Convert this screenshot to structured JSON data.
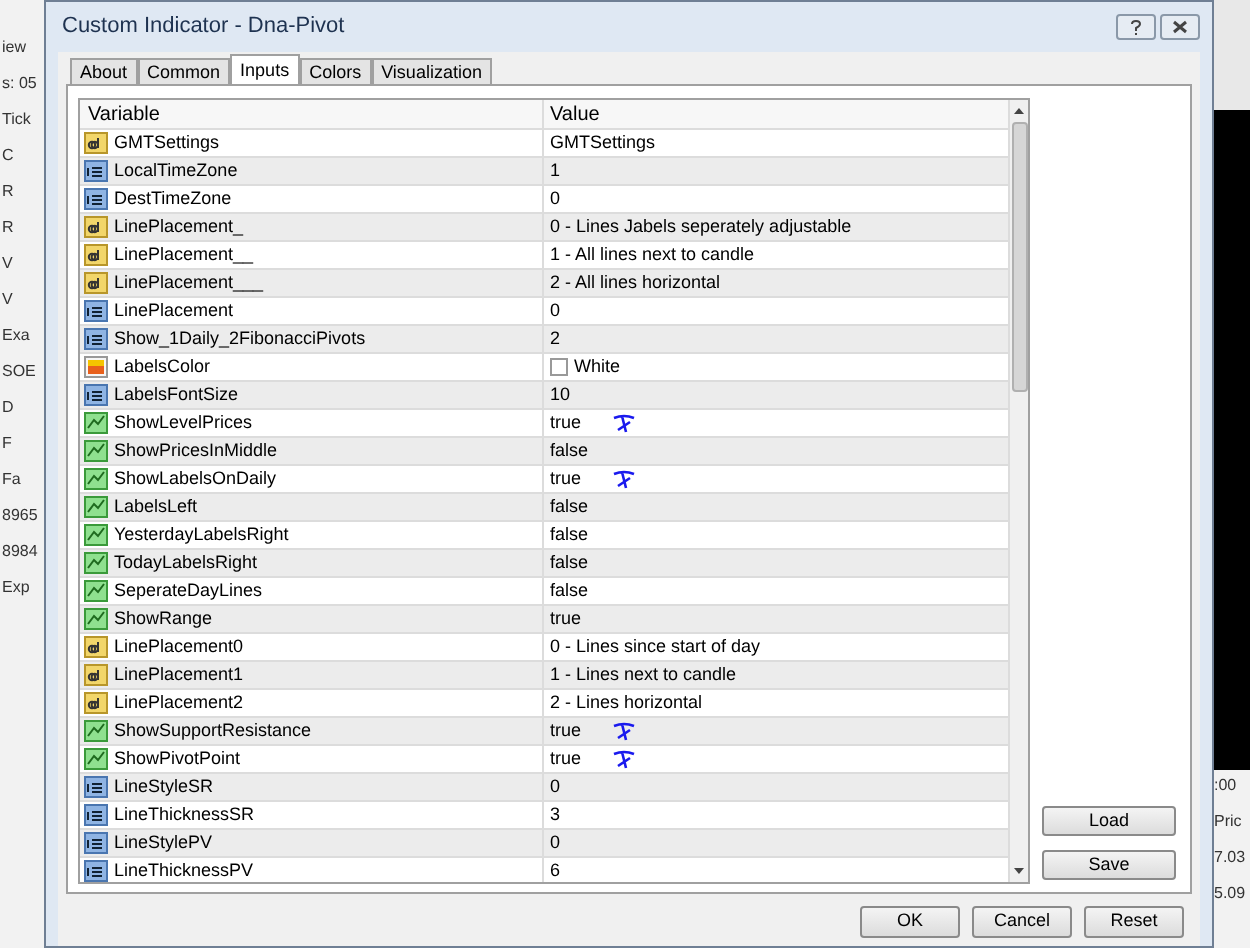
{
  "background_left": {
    "items": [
      "iew",
      "s: 05",
      "Tick",
      "C",
      "R",
      "R",
      "V",
      "V",
      "Exa",
      "SOE",
      "D",
      "F",
      "Fa",
      "8965",
      "8984",
      "Exp"
    ]
  },
  "background_right": {
    "items": [
      ":00",
      "Pric",
      "7.03",
      "5.09"
    ]
  },
  "window": {
    "title": "Custom Indicator - Dna-Pivot"
  },
  "tabs": [
    {
      "label": "About",
      "selected": false
    },
    {
      "label": "Common",
      "selected": false
    },
    {
      "label": "Inputs",
      "selected": true
    },
    {
      "label": "Colors",
      "selected": false
    },
    {
      "label": "Visualization",
      "selected": false
    }
  ],
  "table": {
    "columns": [
      "Variable",
      "Value"
    ],
    "rows": [
      {
        "kind": "string",
        "variable": "GMTSettings",
        "value": "GMTSettings",
        "annotated": false
      },
      {
        "kind": "int",
        "variable": "LocalTimeZone",
        "value": "1",
        "annotated": false
      },
      {
        "kind": "int",
        "variable": "DestTimeZone",
        "value": "0",
        "annotated": false
      },
      {
        "kind": "string",
        "variable": "LinePlacement_",
        "value": "0 - Lines Jabels seperately adjustable",
        "annotated": false
      },
      {
        "kind": "string",
        "variable": "LinePlacement__",
        "value": "1 - All lines next to candle",
        "annotated": false
      },
      {
        "kind": "string",
        "variable": "LinePlacement___",
        "value": "2 - All lines horizontal",
        "annotated": false
      },
      {
        "kind": "int",
        "variable": "LinePlacement",
        "value": "0",
        "annotated": false
      },
      {
        "kind": "int",
        "variable": "Show_1Daily_2FibonacciPivots",
        "value": "2",
        "annotated": false
      },
      {
        "kind": "color",
        "variable": "LabelsColor",
        "value": "White",
        "annotated": false
      },
      {
        "kind": "int",
        "variable": "LabelsFontSize",
        "value": "10",
        "annotated": false
      },
      {
        "kind": "bool",
        "variable": "ShowLevelPrices",
        "value": "true",
        "annotated": true
      },
      {
        "kind": "bool",
        "variable": "ShowPricesInMiddle",
        "value": "false",
        "annotated": false
      },
      {
        "kind": "bool",
        "variable": "ShowLabelsOnDaily",
        "value": "true",
        "annotated": true
      },
      {
        "kind": "bool",
        "variable": "LabelsLeft",
        "value": "false",
        "annotated": false
      },
      {
        "kind": "bool",
        "variable": "YesterdayLabelsRight",
        "value": "false",
        "annotated": false
      },
      {
        "kind": "bool",
        "variable": "TodayLabelsRight",
        "value": "false",
        "annotated": false
      },
      {
        "kind": "bool",
        "variable": "SeperateDayLines",
        "value": "false",
        "annotated": false
      },
      {
        "kind": "bool",
        "variable": "ShowRange",
        "value": "true",
        "annotated": false
      },
      {
        "kind": "string",
        "variable": "LinePlacement0",
        "value": "0 - Lines since start of day",
        "annotated": false
      },
      {
        "kind": "string",
        "variable": "LinePlacement1",
        "value": "1 - Lines next to candle",
        "annotated": false
      },
      {
        "kind": "string",
        "variable": "LinePlacement2",
        "value": "2 - Lines horizontal",
        "annotated": false
      },
      {
        "kind": "bool",
        "variable": "ShowSupportResistance",
        "value": "true",
        "annotated": true
      },
      {
        "kind": "bool",
        "variable": "ShowPivotPoint",
        "value": "true",
        "annotated": true
      },
      {
        "kind": "int",
        "variable": "LineStyleSR",
        "value": "0",
        "annotated": false
      },
      {
        "kind": "int",
        "variable": "LineThicknessSR",
        "value": "3",
        "annotated": false
      },
      {
        "kind": "int",
        "variable": "LineStylePV",
        "value": "0",
        "annotated": false
      },
      {
        "kind": "int",
        "variable": "LineThicknessPV",
        "value": "6",
        "annotated": false
      }
    ]
  },
  "side_buttons": [
    "Load",
    "Save"
  ],
  "buttons": [
    "OK",
    "Cancel",
    "Reset"
  ]
}
